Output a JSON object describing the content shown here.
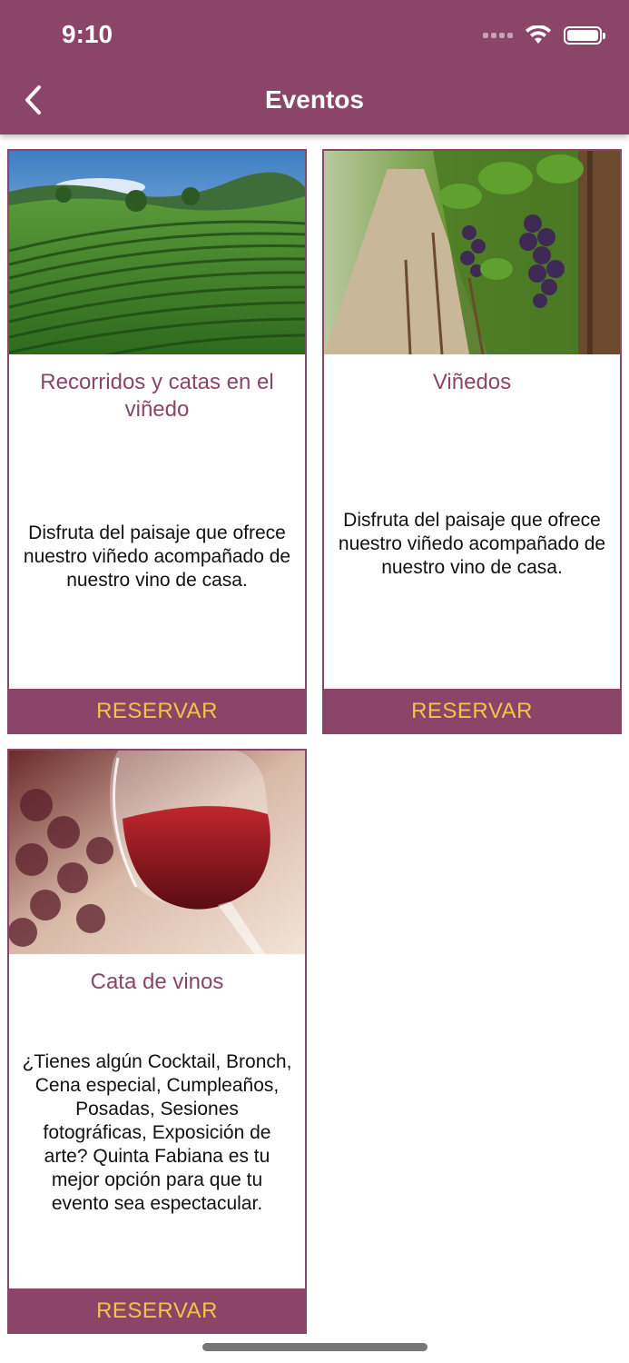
{
  "status_bar": {
    "time": "9:10"
  },
  "nav": {
    "title": "Eventos"
  },
  "cards": [
    {
      "title": "Recorridos y catas en el viñedo",
      "description": "Disfruta del paisaje que ofrece nuestro viñedo acompañado de nuestro vino de casa.",
      "button": "RESERVAR"
    },
    {
      "title": "Viñedos",
      "description": "Disfruta del paisaje que ofrece nuestro viñedo acompañado de nuestro vino de casa.",
      "button": "RESERVAR"
    },
    {
      "title": "Cata de vinos",
      "description": "¿Tienes algún Cocktail, Bronch, Cena especial, Cumpleaños, Posadas, Sesiones fotográficas, Exposición de arte? Quinta Fabiana es tu mejor opción para que tu evento sea espectacular.",
      "button": "RESERVAR"
    }
  ],
  "colors": {
    "brand": "#8a4569",
    "accent": "#f5c24a"
  }
}
